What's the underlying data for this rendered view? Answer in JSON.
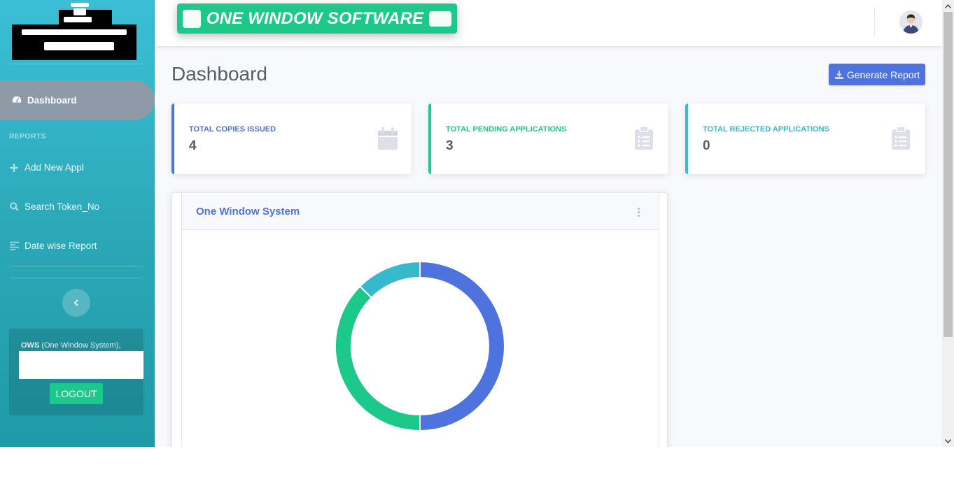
{
  "banner": {
    "text": "ONE WINDOW SOFTWARE"
  },
  "sidebar": {
    "active_item": {
      "label": "Dashboard",
      "icon": "tachometer-icon"
    },
    "heading": "REPORTS",
    "items": [
      {
        "label": "Add New Appl",
        "icon": "plus-icon"
      },
      {
        "label": "Search Token_No",
        "icon": "search-icon"
      },
      {
        "label": "Date wise Report",
        "icon": "align-left-icon"
      }
    ],
    "toggle_icon": "chevron-left-icon",
    "user_card": {
      "brand": "OWS",
      "caption": " (One Window System),",
      "logout_label": "LOGOUT"
    }
  },
  "page": {
    "title": "Dashboard",
    "generate_report_label": "Generate Report"
  },
  "stats": [
    {
      "title": "TOTAL COPIES ISSUED",
      "value": "4",
      "color": "#4e73df",
      "icon": "calendar-icon"
    },
    {
      "title": "TOTAL PENDING APPLICATIONS",
      "value": "3",
      "color": "#1cc88a",
      "icon": "clipboard-list-icon"
    },
    {
      "title": "TOTAL REJECTED APPLICATIONS",
      "value": "0",
      "color": "#36b9cc",
      "icon": "clipboard-list-icon"
    }
  ],
  "chart_card": {
    "title": "One Window System"
  },
  "chart_data": {
    "type": "pie",
    "title": "",
    "categories": [
      "",
      "",
      ""
    ],
    "values": [
      4,
      3,
      1
    ],
    "colors": [
      "#4e73df",
      "#1cc88a",
      "#36b9cc"
    ]
  },
  "colors": {
    "primary": "#4e73df",
    "success": "#1cc88a",
    "info": "#36b9cc",
    "text_gray": "#5a5c69"
  }
}
